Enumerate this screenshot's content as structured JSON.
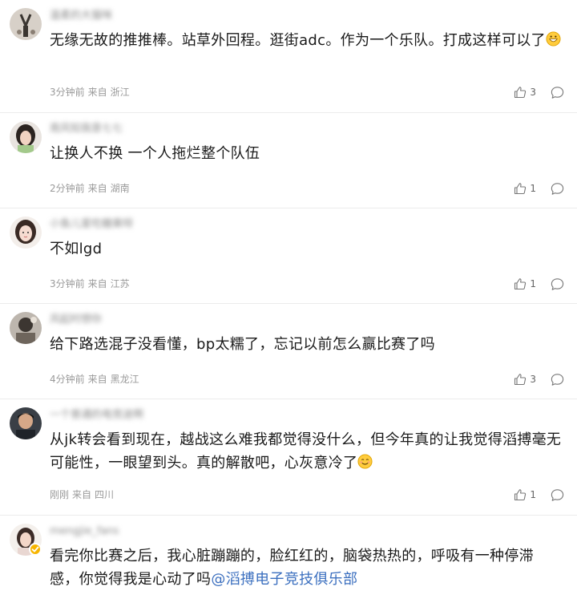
{
  "comments": [
    {
      "username": "温柔的大猫咪",
      "text": "无缘无故的推推棒。站草外回程。逛街adc。作为一个乐队。打成这样可以了",
      "emoji": "grin-emoji",
      "time": "3分钟前",
      "source": "来自",
      "location": "浙江",
      "likes": "3"
    },
    {
      "username": "南风知我意七七",
      "text": "让换人不换 一个人拖烂整个队伍",
      "time": "2分钟前",
      "source": "来自",
      "location": "湖南",
      "likes": "1"
    },
    {
      "username": "小鱼儿爱吃糖果呀",
      "text": "不如lgd",
      "time": "3分钟前",
      "source": "来自",
      "location": "江苏",
      "likes": "1"
    },
    {
      "username": "风起时想你",
      "text": "给下路选混子没看懂，bp太糯了，忘记以前怎么赢比赛了吗",
      "time": "4分钟前",
      "source": "来自",
      "location": "黑龙江",
      "likes": "3"
    },
    {
      "username": "一个普通的电竞迷啊",
      "text": "从jk转会看到现在，越战这么难我都觉得没什么，但今年真的让我觉得滔搏毫无可能性，一眼望到头。真的解散吧，心灰意冷了",
      "emoji": "smile-emoji",
      "time": "刚刚",
      "source": "来自",
      "location": "四川",
      "likes": "1"
    },
    {
      "username": "mengjie_fans",
      "text": "看完你比赛之后，我心脏蹦蹦的，脸红红的，脑袋热热的，呼吸有一种停滞感，你觉得我是心动了吗",
      "mention": "@滔搏电子竞技俱乐部"
    }
  ]
}
